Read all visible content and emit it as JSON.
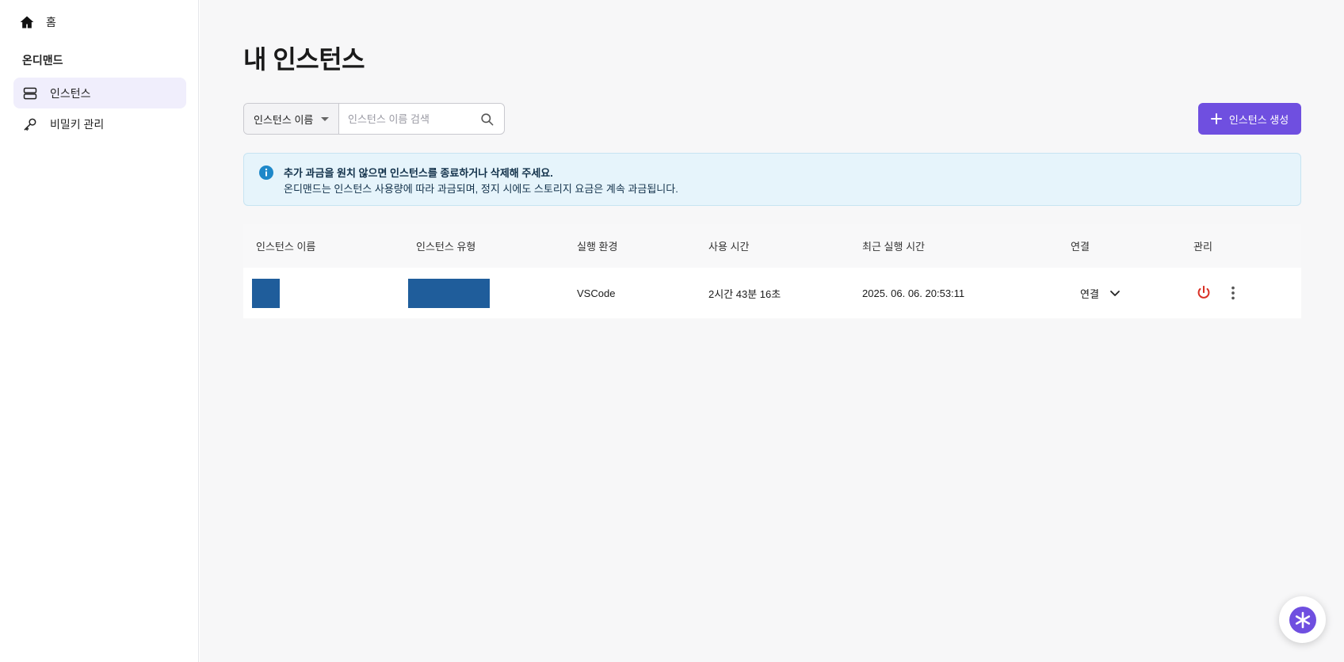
{
  "sidebar": {
    "home_label": "홈",
    "section_title": "온디맨드",
    "items": [
      {
        "label": "인스턴스",
        "icon": "server-icon",
        "active": true
      },
      {
        "label": "비밀키 관리",
        "icon": "key-icon",
        "active": false
      }
    ]
  },
  "main": {
    "page_title": "내 인스턴스",
    "search": {
      "filter_selected": "인스턴스 이름",
      "placeholder": "인스턴스 이름 검색",
      "value": ""
    },
    "create_button_label": "인스턴스 생성",
    "info": {
      "title": "추가 과금을 원치 않으면 인스턴스를 종료하거나 삭제해 주세요.",
      "text": "온디맨드는 인스턴스 사용량에 따라 과금되며, 정지 시에도 스토리지 요금은 계속 과금됩니다."
    },
    "table": {
      "headers": [
        "인스턴스 이름",
        "인스턴스 유형",
        "실행 환경",
        "사용 시간",
        "최근 실행 시간",
        "연결",
        "관리"
      ],
      "rows": [
        {
          "runtime": "VSCode",
          "usage_time": "2시간 43분 16초",
          "last_run": "2025. 06. 06. 20:53:11",
          "connect_label": "연결"
        }
      ]
    }
  },
  "colors": {
    "accent": "#6f4fe0",
    "info_bg": "#e6f4fb",
    "info_icon": "#1e88c9",
    "power": "#d93025",
    "redacted": "#1f5d9b"
  }
}
